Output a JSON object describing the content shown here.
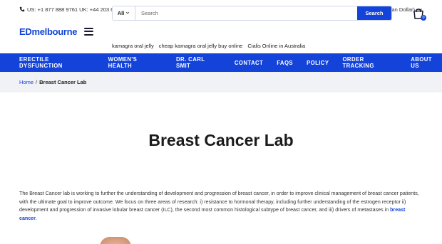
{
  "topbar": {
    "phones": "US: +1 877 888 9761 UK: +44 203 608 1340",
    "currency": "AUD (Australian Dollar)",
    "phone_icon": "phone-icon",
    "chevron_icon": "chevron-down-icon"
  },
  "header": {
    "logo_ed": "ED",
    "logo_rest": "melbourne",
    "menu_icon": "hamburger-icon",
    "cart_icon": "cart-bag-icon",
    "cart_count": "0"
  },
  "search": {
    "category": "All",
    "placeholder": "Search",
    "button_label": "Search"
  },
  "suggestions": [
    "kamagra oral jelly",
    "cheap kamagra oral jelly buy online",
    "Cialis Online in Australia"
  ],
  "nav": {
    "items": [
      "ERECTILE DYSFUNCTION",
      "WOMEN'S HEALTH",
      "DR. CARL SMIT",
      "CONTACT",
      "FAQS",
      "POLICY",
      "ORDER TRACKING",
      "ABOUT US"
    ]
  },
  "breadcrumb": {
    "home": "Home",
    "separator": "/",
    "current": "Breast Cancer Lab"
  },
  "page": {
    "title": "Breast Cancer Lab",
    "paragraph": "The Breast Cancer lab is working to further the understanding of development and progression of breast cancer, in order to improve clinical management of breast cancer patients, with the ultimate goal to improve outcome. We focus on three areas of research: i) resistance to hormonal therapy, including further understanding of the estrogen receptor ii) development and progression of invasive lobular breast cancer (ILC), the second most common histological subtype of breast cancer, and iii) drivers of metastases in",
    "link_text": "breast cancer",
    "paragraph_end": "."
  },
  "colors": {
    "brand": "#1343d8",
    "crumb_bg": "#f1f2f5"
  }
}
